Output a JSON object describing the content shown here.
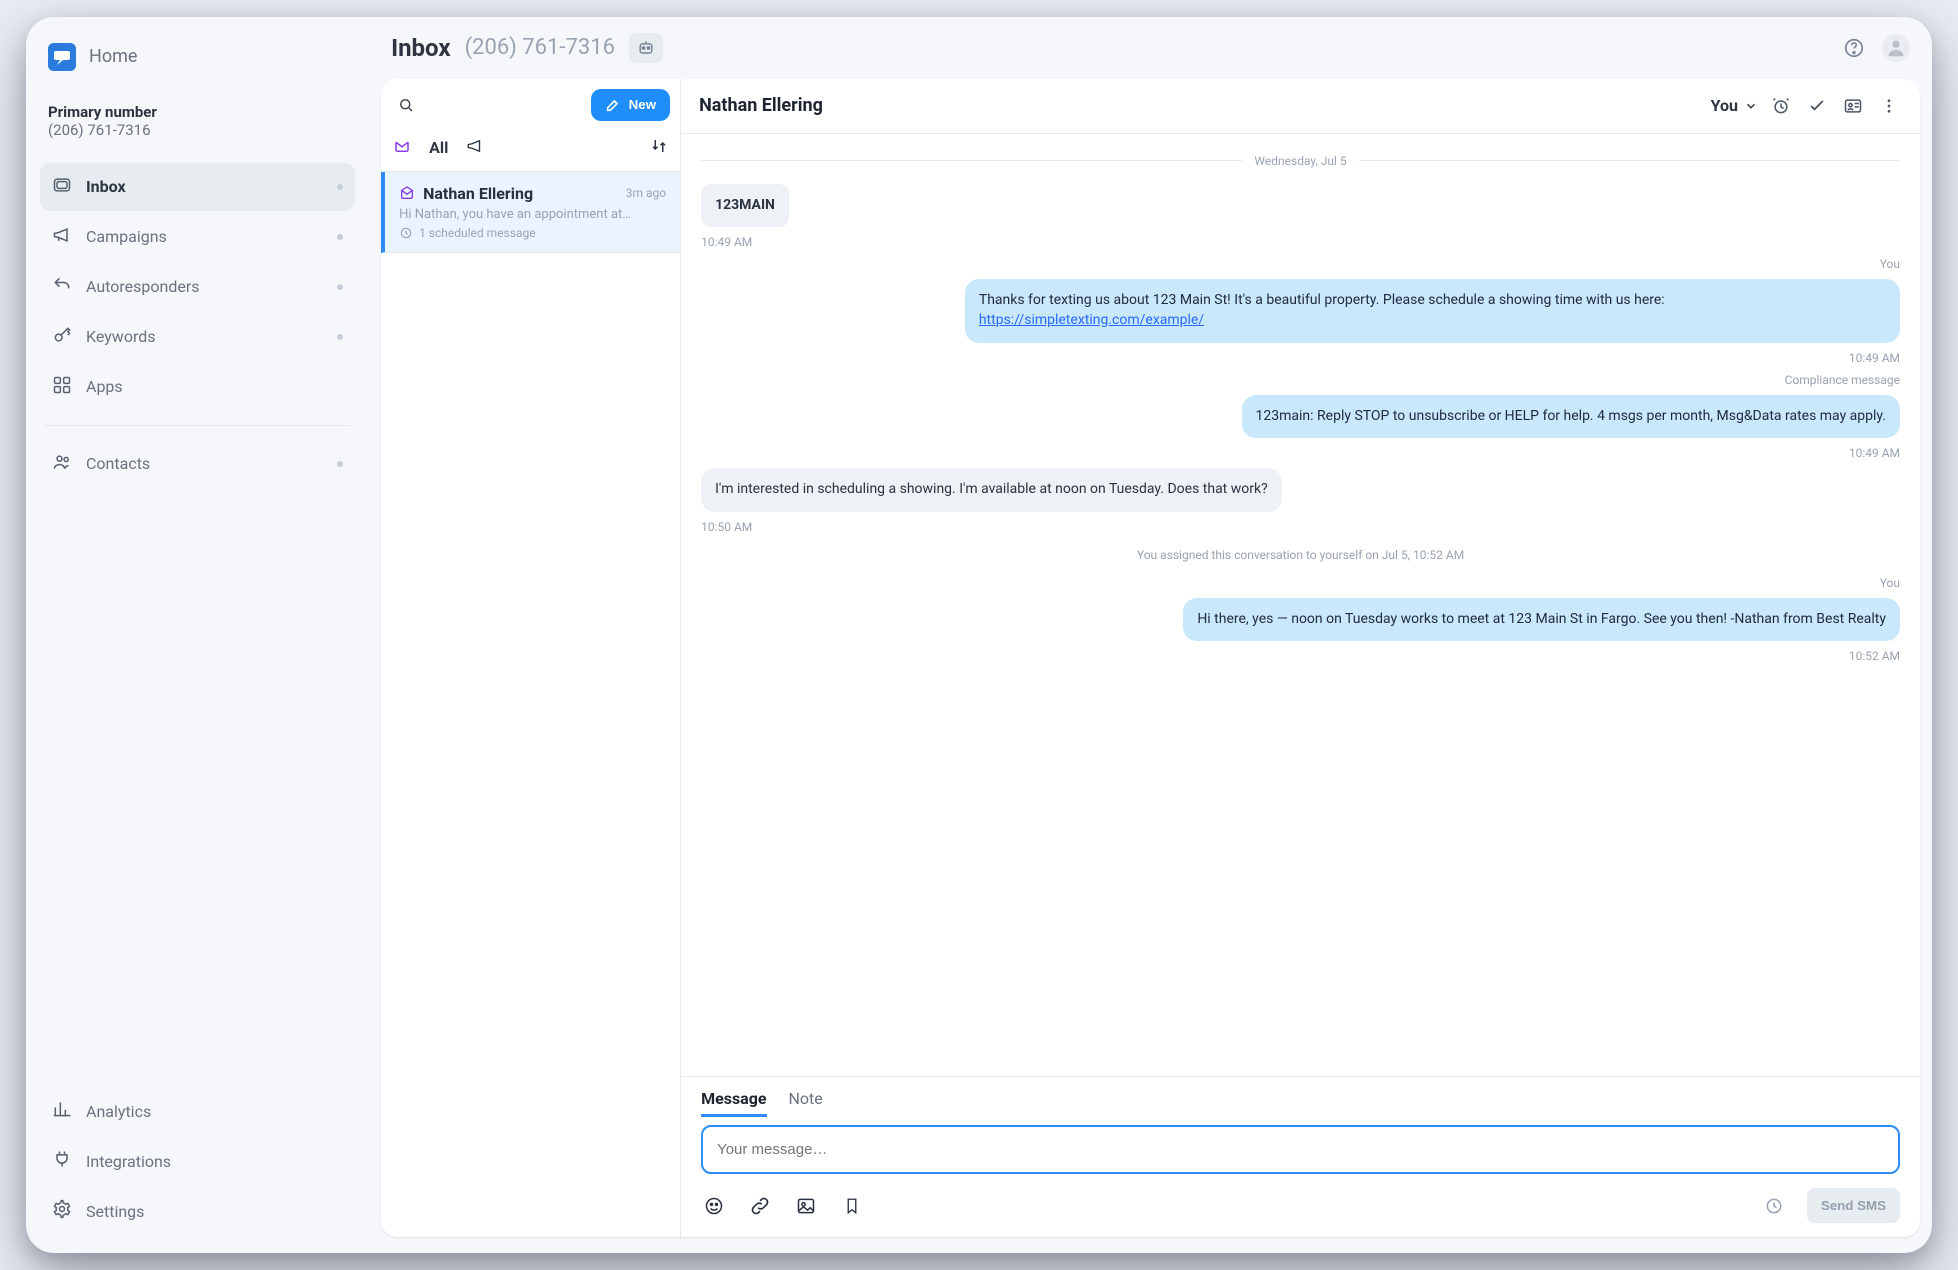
{
  "brand": {
    "home_label": "Home"
  },
  "primary_number": {
    "title": "Primary number",
    "value": "(206) 761-7316"
  },
  "sidebar": {
    "items": [
      {
        "label": "Inbox",
        "has_dot": true,
        "active": true
      },
      {
        "label": "Campaigns",
        "has_dot": true,
        "active": false
      },
      {
        "label": "Autoresponders",
        "has_dot": true,
        "active": false
      },
      {
        "label": "Keywords",
        "has_dot": true,
        "active": false
      },
      {
        "label": "Apps",
        "has_dot": false,
        "active": false
      }
    ],
    "contacts_label": "Contacts",
    "bottom": {
      "analytics_label": "Analytics",
      "integrations_label": "Integrations",
      "settings_label": "Settings"
    }
  },
  "header": {
    "title": "Inbox",
    "phone": "(206) 761-7316"
  },
  "inbox": {
    "new_label": "New",
    "tab_all": "All",
    "threads": [
      {
        "name": "Nathan Ellering",
        "time": "3m ago",
        "preview": "Hi Nathan, you have an appointment at…",
        "scheduled_label": "1 scheduled message"
      }
    ]
  },
  "conversation": {
    "contact_name": "Nathan Ellering",
    "assignee_label": "You",
    "date_separator": "Wednesday, Jul 5",
    "messages": [
      {
        "side": "in",
        "text": "123MAIN",
        "time": "10:49 AM"
      },
      {
        "side": "out",
        "label": "You",
        "text": "Thanks for texting us about 123 Main St! It's a beautiful property. Please schedule a showing time with us here: ",
        "link_text": "https://simpletexting.com/example/",
        "time": "10:49 AM"
      },
      {
        "side": "out",
        "label": "Compliance message",
        "text": "123main: Reply STOP to unsubscribe or HELP for help. 4 msgs per month, Msg&Data rates may apply.",
        "time": "10:49 AM"
      },
      {
        "side": "in",
        "text": "I'm interested in scheduling a showing. I'm available at noon on Tuesday. Does that work?",
        "time": "10:50 AM"
      },
      {
        "side": "system",
        "text": "You assigned this conversation to yourself on Jul 5, 10:52 AM"
      },
      {
        "side": "out",
        "label": "You",
        "text": "Hi there, yes — noon on Tuesday works to meet at 123 Main St in Fargo. See you then! -Nathan from Best Realty",
        "time": "10:52 AM"
      }
    ],
    "composer": {
      "tab_message": "Message",
      "tab_note": "Note",
      "placeholder": "Your message…",
      "send_label": "Send SMS"
    }
  }
}
